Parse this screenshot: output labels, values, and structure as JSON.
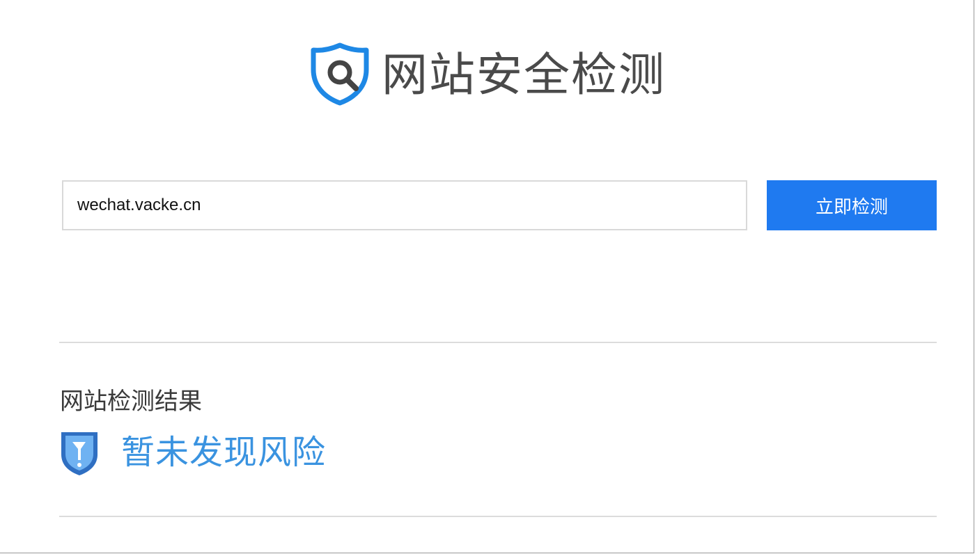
{
  "header": {
    "title": "网站安全检测",
    "logo_icon": "shield-search-icon"
  },
  "search": {
    "value": "wechat.vacke.cn",
    "button_label": "立即检测"
  },
  "result": {
    "heading": "网站检测结果",
    "status_text": "暂未发现风险",
    "status_icon": "shield-unknown-icon"
  },
  "colors": {
    "accent": "#1f7af0",
    "status": "#3a93e0",
    "title": "#4a4a4a"
  }
}
